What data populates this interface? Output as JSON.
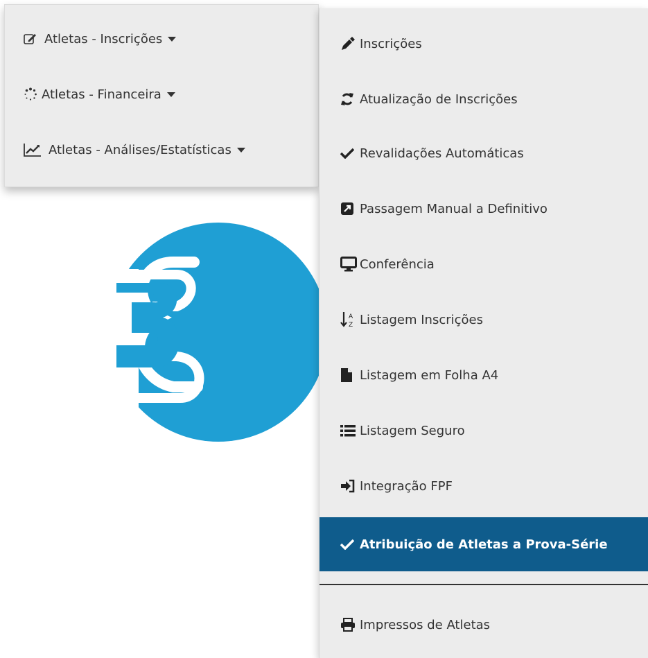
{
  "left_menu": {
    "items": [
      {
        "label": "Atletas - Inscrições",
        "icon": "edit-icon"
      },
      {
        "label": "Atletas - Financeira",
        "icon": "spinner-icon"
      },
      {
        "label": "Atletas - Análises/Estatísticas",
        "icon": "line-chart-icon"
      }
    ]
  },
  "submenu": {
    "items": [
      {
        "label": "Inscrições",
        "icon": "eyedropper-icon"
      },
      {
        "label": "Atualização de Inscrições",
        "icon": "refresh-icon"
      },
      {
        "label": "Revalidações Automáticas",
        "icon": "check-icon"
      },
      {
        "label": "Passagem Manual a Definitivo",
        "icon": "external-link-square-icon"
      },
      {
        "label": "Conferência",
        "icon": "desktop-icon"
      },
      {
        "label": "Listagem Inscrições",
        "icon": "sort-alpha-icon"
      },
      {
        "label": "Listagem em Folha A4",
        "icon": "file-icon"
      },
      {
        "label": "Listagem Seguro",
        "icon": "list-icon"
      },
      {
        "label": "Integração FPF",
        "icon": "sign-in-icon"
      },
      {
        "label": "Atribuição de Atletas a Prova-Série",
        "icon": "check-icon",
        "active": true
      },
      {
        "label": "Impressos de Atletas",
        "icon": "print-icon"
      }
    ]
  },
  "colors": {
    "active_bg": "#0f5c8c",
    "logo": "#1f9fd4",
    "menu_bg": "#ececec"
  }
}
